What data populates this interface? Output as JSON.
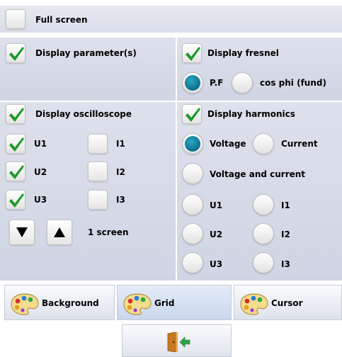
{
  "full_screen": {
    "label": "Full screen",
    "checked": false
  },
  "display_parameters": {
    "label": "Display parameter(s)",
    "checked": true
  },
  "display_fresnel": {
    "label": "Display fresnel",
    "checked": true,
    "options": [
      {
        "label": "P.F",
        "selected": true
      },
      {
        "label": "cos phi (fund)",
        "selected": false
      }
    ]
  },
  "oscilloscope": {
    "label": "Display oscilloscope",
    "checked": true,
    "voltages": [
      {
        "label": "U1",
        "checked": true
      },
      {
        "label": "U2",
        "checked": true
      },
      {
        "label": "U3",
        "checked": true
      }
    ],
    "currents": [
      {
        "label": "I1",
        "checked": false
      },
      {
        "label": "I2",
        "checked": false
      },
      {
        "label": "I3",
        "checked": false
      }
    ],
    "screen_label": "1 screen"
  },
  "harmonics": {
    "label": "Display harmonics",
    "checked": true,
    "modes": [
      {
        "label": "Voltage",
        "selected": true
      },
      {
        "label": "Current",
        "selected": false
      },
      {
        "label": "Voltage and current",
        "selected": false
      }
    ],
    "channels_left": [
      {
        "label": "U1",
        "selected": false
      },
      {
        "label": "U2",
        "selected": false
      },
      {
        "label": "U3",
        "selected": false
      }
    ],
    "channels_right": [
      {
        "label": "I1",
        "selected": false
      },
      {
        "label": "I2",
        "selected": false
      },
      {
        "label": "I3",
        "selected": false
      }
    ]
  },
  "color_buttons": {
    "background": "Background",
    "grid": "Grid",
    "cursor": "Cursor"
  },
  "icons": {
    "palette": "palette-icon",
    "exit": "exit-door-icon",
    "check": "check-icon",
    "down": "arrow-down-icon",
    "up": "arrow-up-icon"
  },
  "colors": {
    "check_green": "#1d9a2a",
    "radio_teal": "#0c6f8b",
    "panel_bg": "#d7dbe7"
  }
}
